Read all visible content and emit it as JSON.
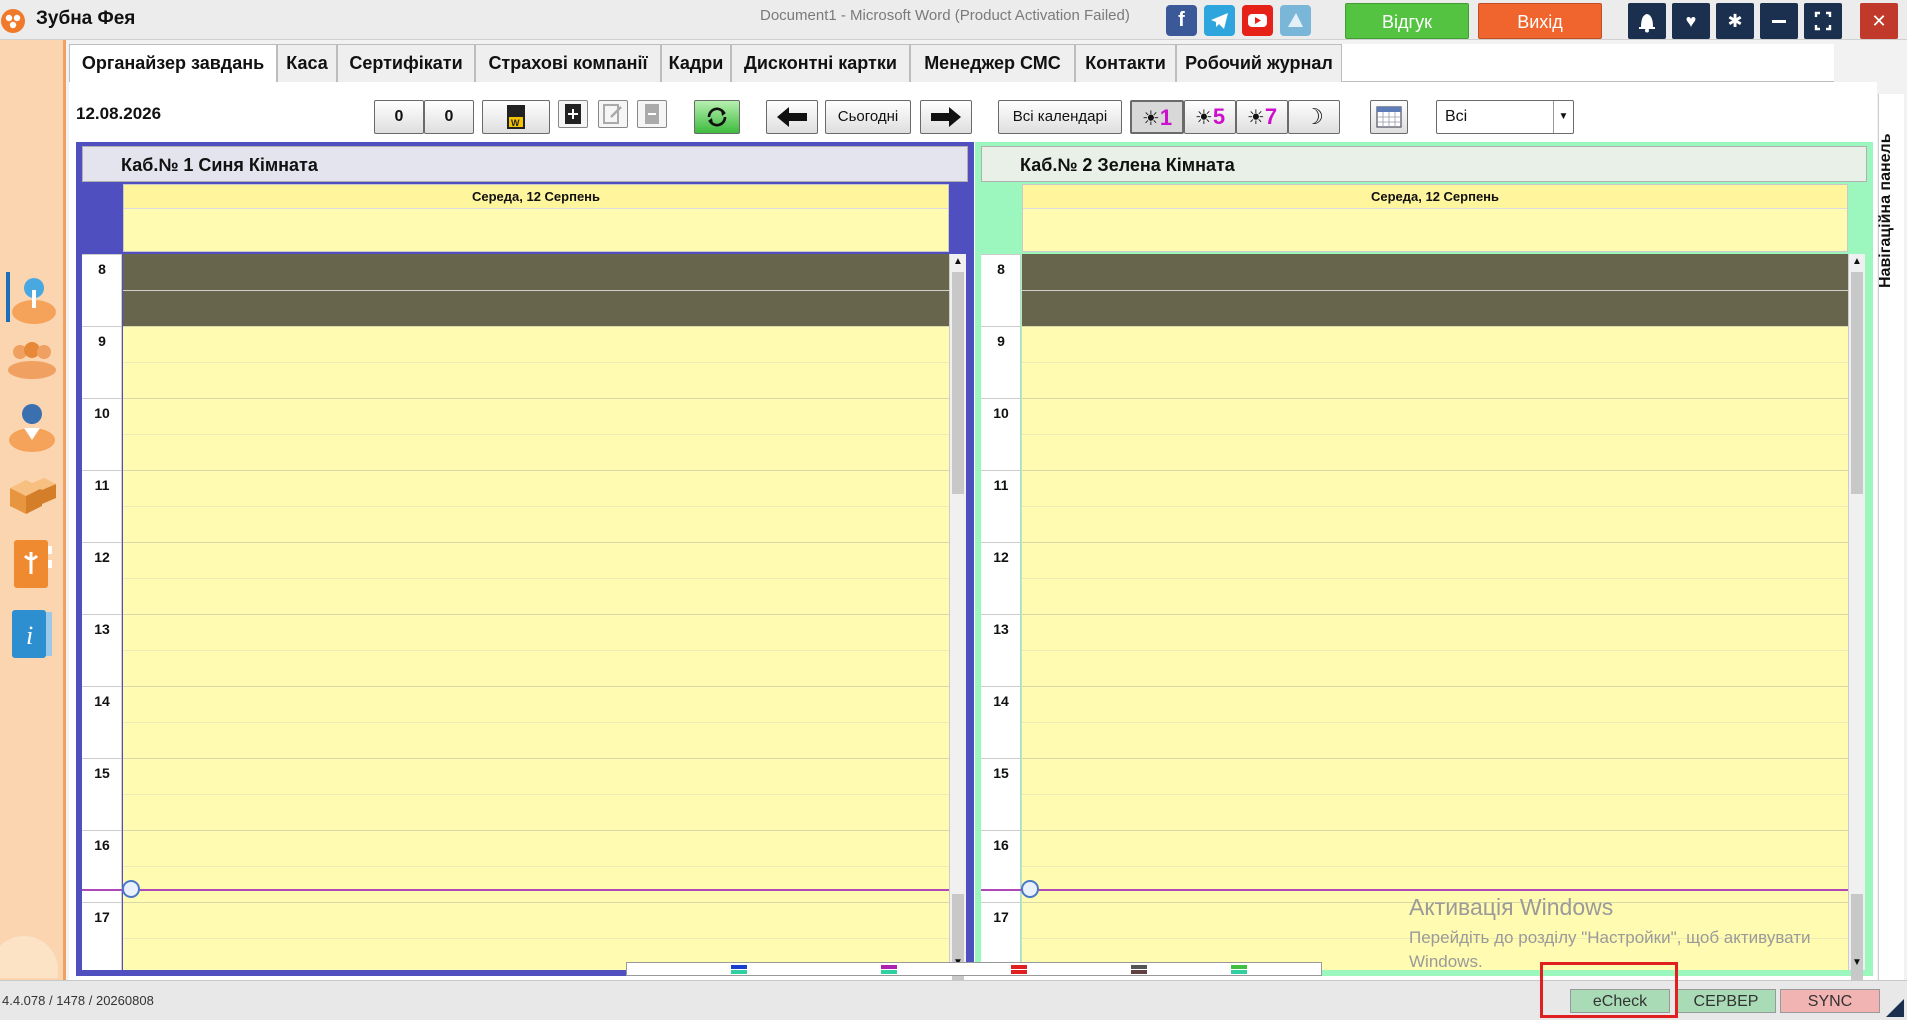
{
  "app": {
    "name": "Зубна Фея",
    "window_title": "Document1  -  Microsoft Word (Product Activation Failed)"
  },
  "header_buttons": {
    "feedback": "Відгук",
    "exit": "Вихід"
  },
  "social_icons": [
    "facebook-icon",
    "telegram-icon",
    "youtube-icon",
    "remote-support-icon"
  ],
  "window_controls": [
    "bell-icon",
    "heart-icon",
    "gear-icon",
    "minimize-icon",
    "maximize-icon",
    "close-icon"
  ],
  "sidebar": {
    "items": [
      "patient-icon",
      "group-icon",
      "doctor-icon",
      "boxes-icon",
      "clinic-book-icon",
      "info-book-icon"
    ]
  },
  "tabs": [
    {
      "label": "Органайзер завдань",
      "active": true
    },
    {
      "label": "Каса"
    },
    {
      "label": "Сертифікати"
    },
    {
      "label": "Страхові компанії"
    },
    {
      "label": "Кадри"
    },
    {
      "label": "Дисконтні картки"
    },
    {
      "label": "Менеджер СМС"
    },
    {
      "label": "Контакти"
    },
    {
      "label": "Робочий журнал"
    }
  ],
  "toolbar": {
    "date": "12.08.2026",
    "counter_a": "0",
    "counter_b": "0",
    "today_label": "Сьогодні",
    "all_calendars_label": "Всі календарі",
    "view_1": "1",
    "view_5": "5",
    "view_7": "7",
    "filter_value": "Всі"
  },
  "calendars": [
    {
      "name": "Каб.№ 1 Синя Кімната",
      "day_title": "Середа, 12 Серпень",
      "accent": "#4f4fbf"
    },
    {
      "name": "Каб.№ 2 Зелена Кімната",
      "day_title": "Середа, 12 Серпень",
      "accent": "#9cf7bf"
    }
  ],
  "hours": [
    "8",
    "9",
    "10",
    "11",
    "12",
    "13",
    "14",
    "15",
    "16",
    "17"
  ],
  "nav_panel_label": "Навігаційна панель",
  "watermark": {
    "title": "Активація Windows",
    "subtitle": "Перейдіть до розділу \"Настройки\", щоб активувати Windows."
  },
  "status_bar": {
    "version": "4.4.078 / 1478 / 20260808",
    "echeck": "eCheck",
    "server": "СЕРВЕР",
    "sync": "SYNC"
  },
  "colors": {
    "feedback_button": "#55c342",
    "exit_button": "#f0642d",
    "day_bg": "#fffbb0",
    "blocked": "#67654b",
    "now_line": "#b048b8"
  }
}
